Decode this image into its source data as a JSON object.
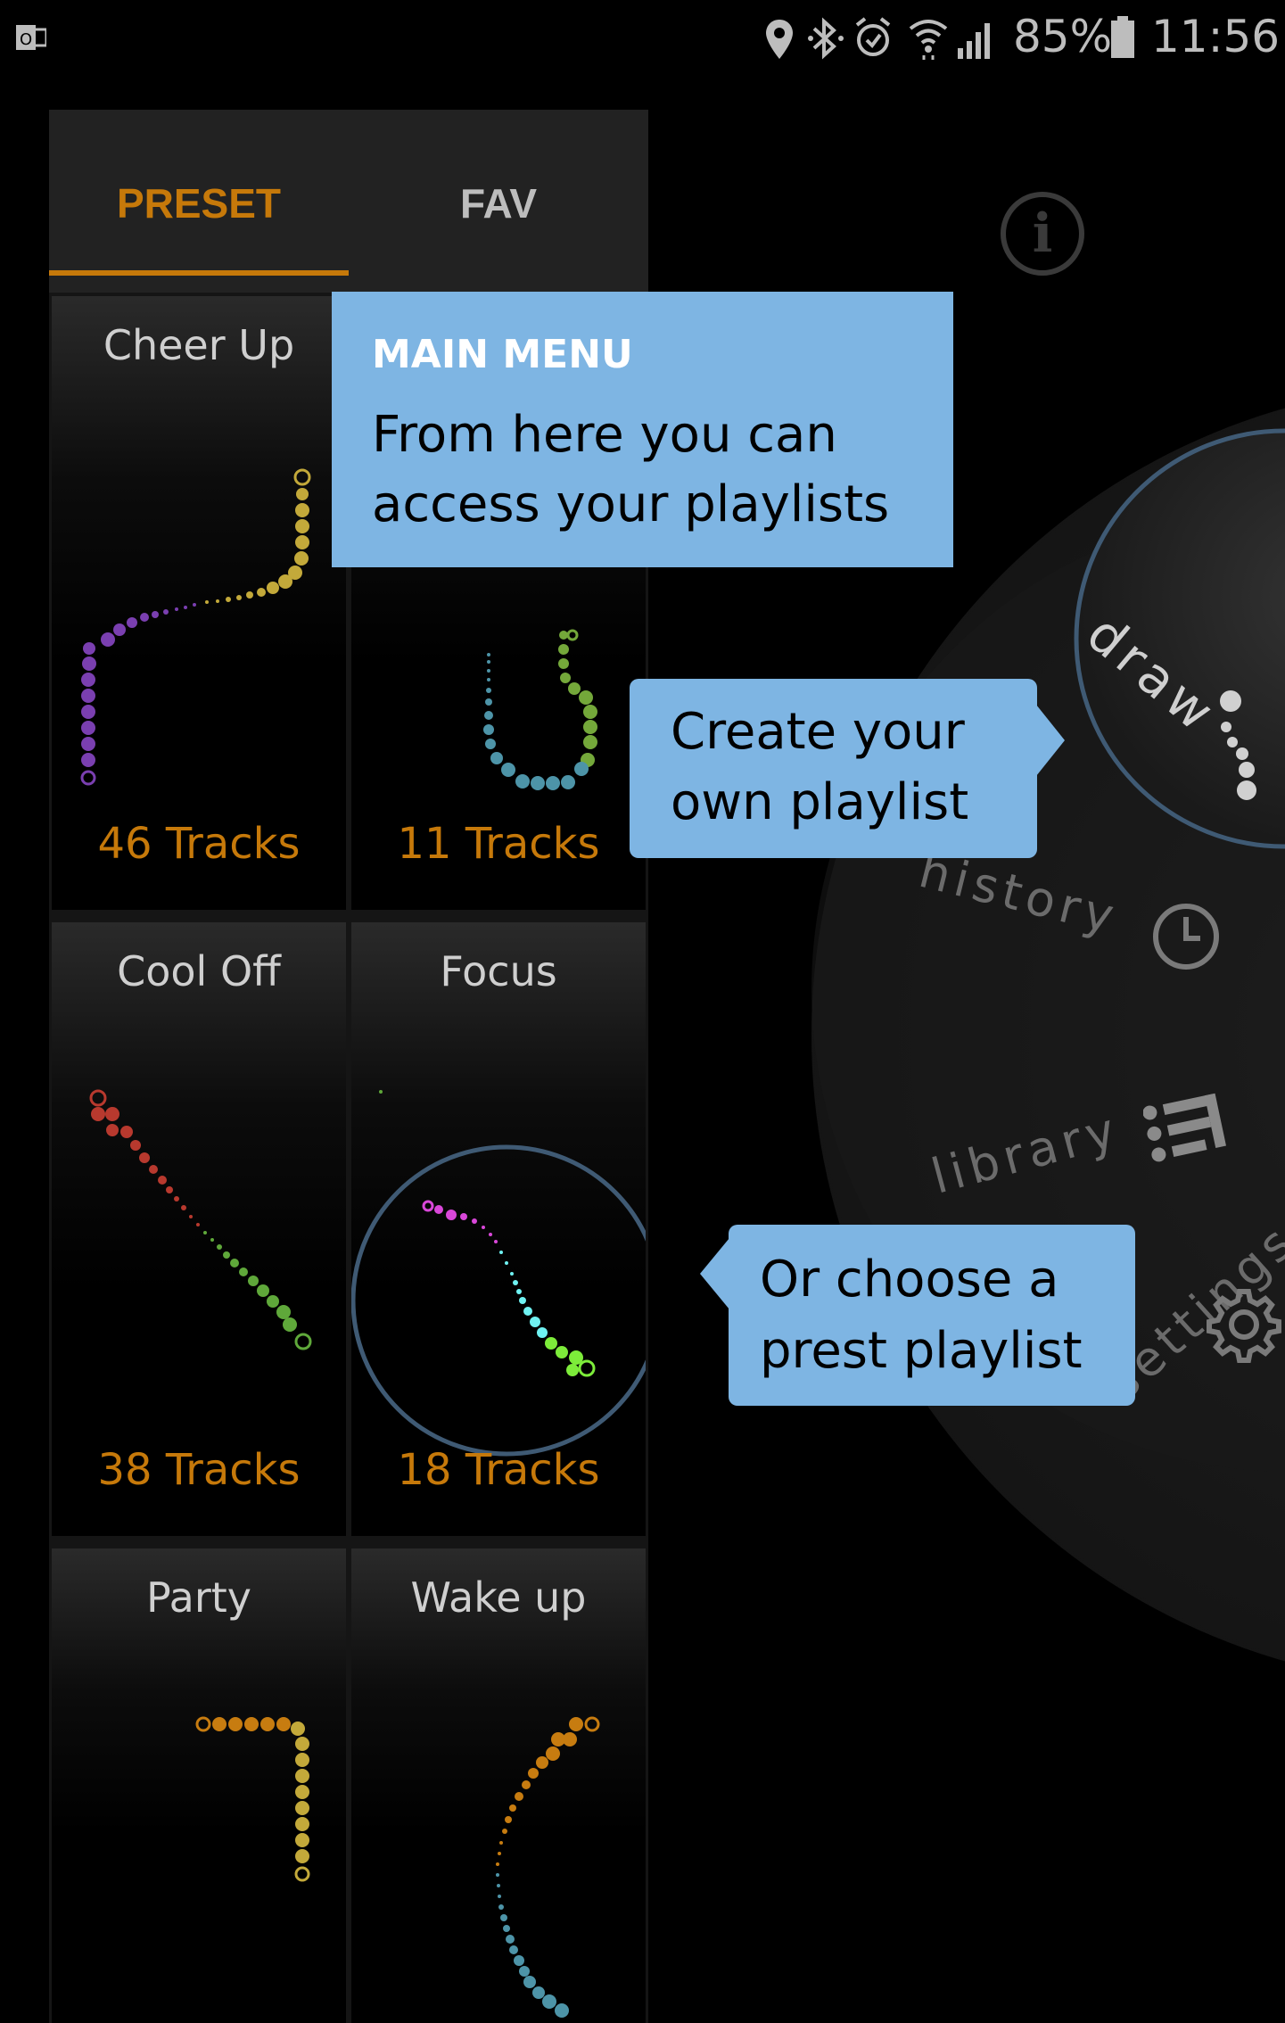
{
  "status_bar": {
    "battery": "85%",
    "time": "11:56",
    "icons": [
      "outlook-icon",
      "location-icon",
      "bluetooth-icon",
      "alarm-icon",
      "wifi-icon",
      "signal-icon",
      "battery-icon"
    ]
  },
  "tabs": [
    {
      "label": "PRESET",
      "active": true
    },
    {
      "label": "FAV",
      "active": false
    }
  ],
  "playlists": [
    {
      "name": "Cheer Up",
      "tracks": "46 Tracks"
    },
    {
      "name": "",
      "tracks": "11 Tracks"
    },
    {
      "name": "Cool Off",
      "tracks": "38 Tracks"
    },
    {
      "name": "Focus",
      "tracks": "18 Tracks"
    },
    {
      "name": "Party",
      "tracks": ""
    },
    {
      "name": "Wake up",
      "tracks": ""
    }
  ],
  "tooltips": {
    "main_menu_heading": "MAIN MENU",
    "main_menu_body": "From here you can access your playlists",
    "create": "Create your own playlist",
    "preset": "Or choose a prest playlist"
  },
  "radial_menu": {
    "draw": "draw",
    "history": "history",
    "library": "library",
    "settings": "settings"
  },
  "colors": {
    "accent": "#c6790a",
    "tooltip": "#7eb5e3",
    "ring": "#3f5a74"
  }
}
